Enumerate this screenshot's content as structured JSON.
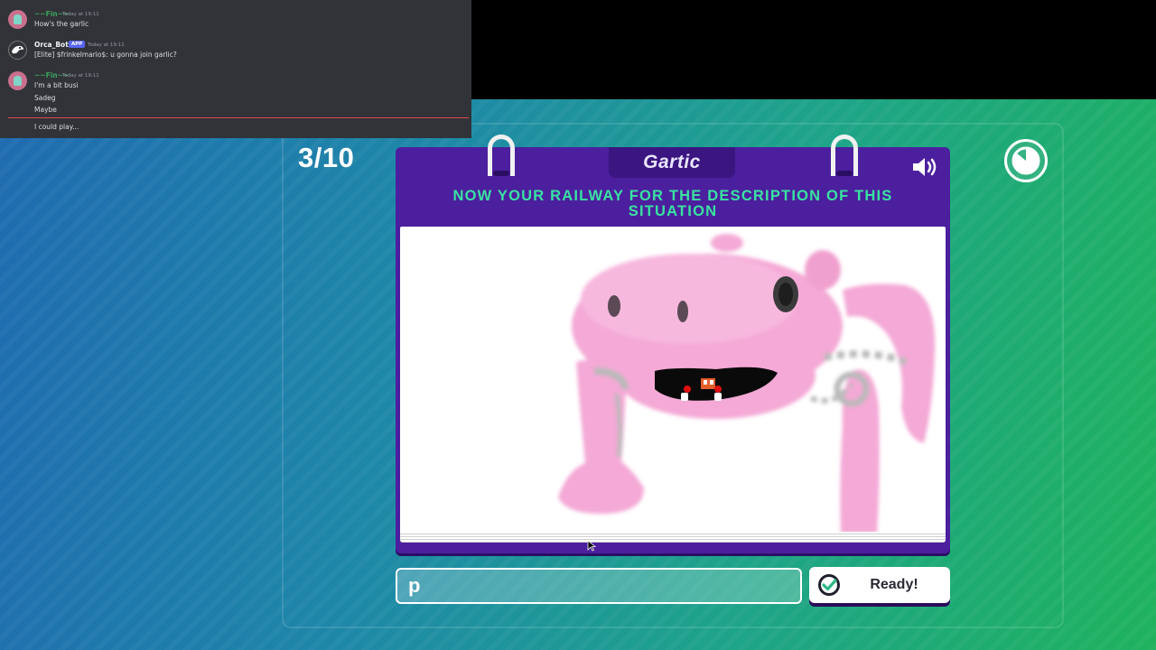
{
  "chat": {
    "messages": [
      {
        "author": "~~Fin~~",
        "timestamp": "Today at 19:11",
        "lines": [
          "How's the garlic"
        ]
      },
      {
        "author": "Orca_Bot",
        "tag": "APP",
        "timestamp": "Today at 19:11",
        "lines": [
          "[Elite] $frinkelmario$: u gonna join garlic?"
        ]
      },
      {
        "author": "~~Fin~~",
        "timestamp": "Today at 19:11",
        "lines": [
          "I'm a bit busi",
          "Sadeg",
          "Maybe"
        ]
      }
    ],
    "new_message": "I could play..."
  },
  "game": {
    "round": "3/10",
    "logo": "Gartic",
    "prompt": "NOW YOUR RAILWAY FOR THE DESCRIPTION OF THIS SITUATION",
    "answer_value": "p",
    "ready_label": "Ready!",
    "timer_icon": "timer-icon",
    "colors": {
      "card": "#4c1f9e",
      "prompt_text": "#39e3a1",
      "drawing_pink": "#f4a9d6"
    }
  }
}
